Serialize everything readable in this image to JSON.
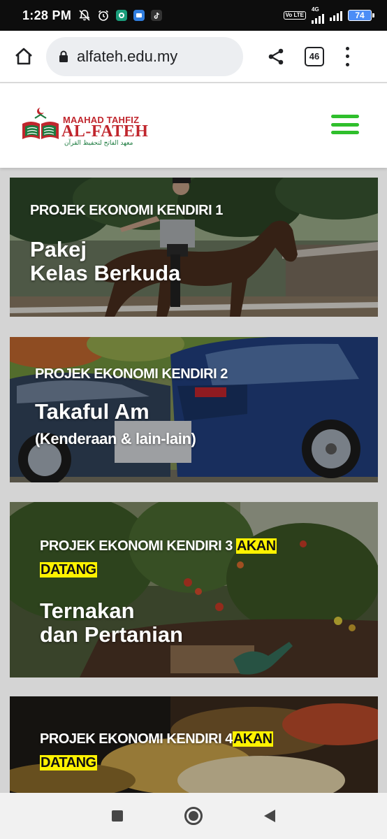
{
  "status_bar": {
    "time": "1:28 PM",
    "network": "4G",
    "volte": "Vo LTE",
    "battery": "74"
  },
  "browser": {
    "url": "alfateh.edu.my",
    "tab_count": "46"
  },
  "site": {
    "logo": {
      "line1": "MAAHAD TAHFIZ",
      "line2": "AL-FATEH",
      "line3": "معهد الفاتح لتحفيظ القرآن"
    },
    "accent_color": "#2fbf2c"
  },
  "cards": [
    {
      "kicker": "PROJEK EKONOMI KENDIRI 1",
      "title_line1": "Pakej",
      "title_line2": "Kelas Berkuda"
    },
    {
      "kicker": "PROJEK EKONOMI KENDIRI 2",
      "title": "Takaful Am",
      "subtitle": "(Kenderaan & lain-lain)"
    },
    {
      "kicker": "PROJEK EKONOMI KENDIRI 3",
      "badge_part1": "AKAN",
      "badge_part2": "DATANG",
      "title_line1": "Ternakan",
      "title_line2": "dan Pertanian"
    },
    {
      "kicker": "PROJEK EKONOMI KENDIRI 4",
      "badge_part1": "AKAN",
      "badge_part2": "DATANG"
    }
  ],
  "icons": {
    "status": [
      "mute-icon",
      "alarm-icon",
      "messenger-icon",
      "app-icon",
      "tiktok-icon",
      "wifi-signal-icon",
      "signal-icon",
      "battery-icon"
    ],
    "browser": [
      "home-icon",
      "lock-icon",
      "share-icon",
      "tabs-icon",
      "more-vert-icon"
    ],
    "nav": [
      "recents-icon",
      "home-nav-icon",
      "back-icon"
    ]
  }
}
